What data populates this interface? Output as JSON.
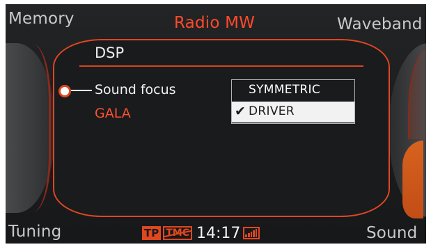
{
  "softkeys": {
    "top_left": "Memory",
    "title": "Radio MW",
    "top_right": "Waveband",
    "bottom_left": "Tuning",
    "bottom_right": "Sound"
  },
  "panel": {
    "title": "DSP",
    "items": [
      {
        "label": "Sound focus",
        "selected": true
      },
      {
        "label": "GALA",
        "selected": false
      }
    ]
  },
  "dropdown": {
    "options": [
      "SYMMETRIC",
      "DRIVER"
    ],
    "selected": "DRIVER",
    "check_glyph": "✔"
  },
  "status": {
    "tp": "TP",
    "tmc": "TMC",
    "time": "14:17",
    "signal_icon": "signal-strength-icon"
  },
  "colors": {
    "accent": "#e0471f",
    "highlight_text": "#ff5030",
    "background": "#1b1c1e"
  }
}
